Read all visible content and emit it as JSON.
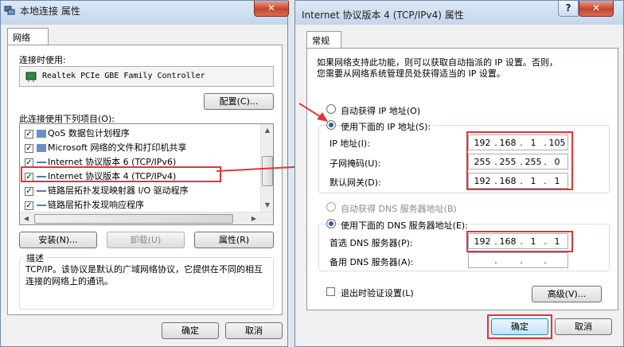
{
  "left_window": {
    "title": "本地连接 属性",
    "close_label": "✕",
    "tab_network": "网络",
    "connect_using_label": "连接时使用:",
    "adapter_name": "Realtek PCIe GBE Family Controller",
    "configure_label": "配置(C)...",
    "items_label": "此连接使用下列项目(O):",
    "items": [
      {
        "label": "QoS 数据包计划程序",
        "checked": true
      },
      {
        "label": "Microsoft 网络的文件和打印机共享",
        "checked": true
      },
      {
        "label": "Internet 协议版本 6 (TCP/IPv6)",
        "checked": true
      },
      {
        "label": "Internet 协议版本 4 (TCP/IPv4)",
        "checked": true
      },
      {
        "label": "链路层拓扑发现映射器 I/O 驱动程序",
        "checked": true
      },
      {
        "label": "链路层拓扑发现响应程序",
        "checked": true
      }
    ],
    "install_label": "安装(N)...",
    "uninstall_label": "卸载(U)",
    "properties_label": "属性(R)",
    "description_title": "描述",
    "description_text": "TCP/IP。该协议是默认的广域网络协议，它提供在不同的相互连接的网络上的通讯。",
    "ok_label": "确定",
    "cancel_label": "取消"
  },
  "right_window": {
    "title": "Internet 协议版本 4 (TCP/IPv4) 属性",
    "help_label": "?",
    "close_label": "✕",
    "tab_general": "常规",
    "intro_line1": "如果网络支持此功能，则可以获取自动指派的 IP 设置。否则，",
    "intro_line2": "您需要从网络系统管理员处获得适当的 IP 设置。",
    "auto_ip_label": "自动获得 IP 地址(O)",
    "use_ip_label": "使用下面的 IP 地址(S):",
    "ip_address_label": "IP 地址(I):",
    "subnet_label": "子网掩码(U):",
    "gateway_label": "默认网关(D):",
    "ip_address": [
      "192",
      "168",
      "1",
      "105"
    ],
    "subnet_mask": [
      "255",
      "255",
      "255",
      "0"
    ],
    "gateway": [
      "192",
      "168",
      "1",
      "1"
    ],
    "auto_dns_label": "自动获得 DNS 服务器地址(B)",
    "use_dns_label": "使用下面的 DNS 服务器地址(E):",
    "preferred_dns_label": "首选 DNS 服务器(P):",
    "alternate_dns_label": "备用 DNS 服务器(A):",
    "preferred_dns": [
      "192",
      "168",
      "1",
      "1"
    ],
    "alternate_dns": [
      "",
      "",
      "",
      ""
    ],
    "validate_label": "退出时验证设置(L)",
    "advanced_label": "高级(V)...",
    "ok_label": "确定",
    "cancel_label": "取消",
    "dot": "."
  },
  "colors": {
    "highlight": "#e03636",
    "accent": "#3c7fb1"
  }
}
